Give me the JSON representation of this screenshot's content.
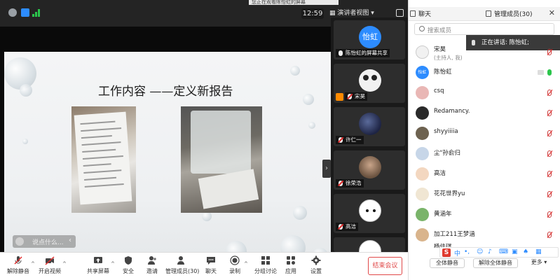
{
  "banner": {
    "text": "您正在观看陈怡虹的屏幕"
  },
  "status": {
    "clock": "12:59",
    "view_label": "演讲者视图"
  },
  "slide": {
    "title": "工作内容 ——定义新报告"
  },
  "chat_pill": {
    "placeholder": "说点什么..."
  },
  "videos": [
    {
      "name": "陈怡虹的屏幕共享",
      "avatar_text": "怡虹"
    },
    {
      "name": "宋昊"
    },
    {
      "name": "许仁一"
    },
    {
      "name": "徐荣浩"
    },
    {
      "name": "高洁"
    }
  ],
  "panel": {
    "tab_chat": "聊天",
    "tab_manage": "管理成员(30)",
    "search_placeholder": "搜索成员",
    "speaking": "正在讲话: 陈怡虹;",
    "avatar_chen": "怡虹",
    "participants": [
      {
        "name": "宋昊",
        "sub": "(主持人, 我)"
      },
      {
        "name": "陈怡虹"
      },
      {
        "name": "csq"
      },
      {
        "name": "Redamancy."
      },
      {
        "name": "shyyiiiia"
      },
      {
        "name": "尘\"孙俞归"
      },
      {
        "name": "高洁"
      },
      {
        "name": "花花世界yu"
      },
      {
        "name": "黄涵年"
      },
      {
        "name": "加工211王梦涵"
      },
      {
        "name": "杨佳琪"
      }
    ],
    "btn_mute_all": "全体静音",
    "btn_unmute_all": "解除全体静音",
    "btn_more": "更多",
    "ime_text": "中"
  },
  "toolbar": {
    "unmute": "解除静音",
    "start_video": "开启视频",
    "share": "共享屏幕",
    "security": "安全",
    "invite": "邀请",
    "manage": "管理成员(30)",
    "chat": "聊天",
    "record": "录制",
    "breakout": "分组讨论",
    "apps": "应用",
    "settings": "设置",
    "end": "结束会议"
  },
  "colors": {
    "accent": "#2d8cff",
    "danger": "#e04848",
    "green": "#2bc54b"
  }
}
